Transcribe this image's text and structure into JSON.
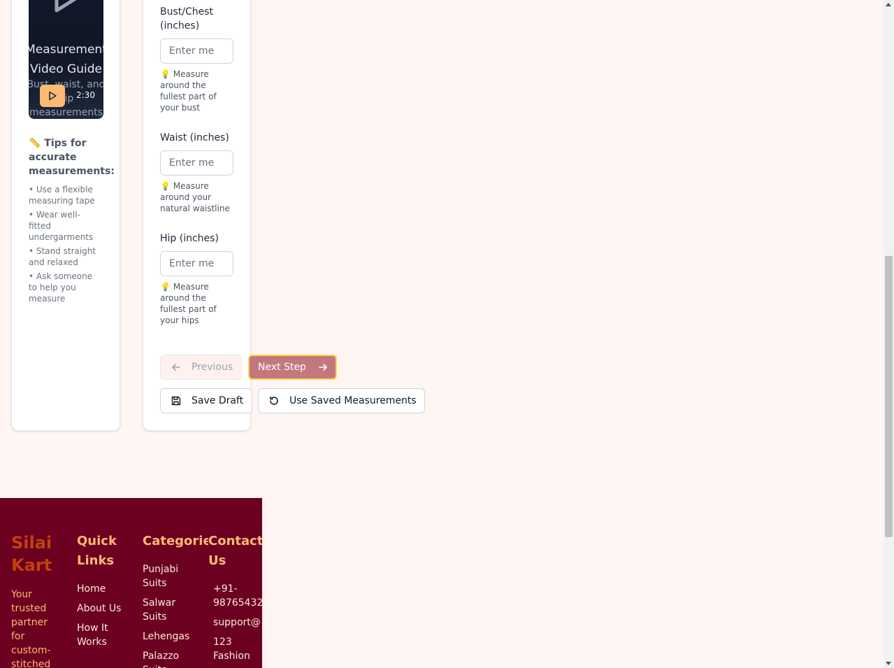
{
  "video_card": {
    "title": "Measurement\nVideo Guide",
    "subtitle": "Bust, waist, and hip measurements",
    "duration": "2:30",
    "tips_title": "📏 Tips for accurate measurements:",
    "tips": [
      "• Use a flexible measuring tape",
      "• Wear well-fitted undergarments",
      "• Stand straight and relaxed",
      "• Ask someone to help you measure"
    ]
  },
  "form": {
    "fields": [
      {
        "label": "Bust/Chest (inches)",
        "placeholder": "Enter me",
        "hint": "💡 Measure around the fullest part of your bust"
      },
      {
        "label": "Waist (inches)",
        "placeholder": "Enter me",
        "hint": "💡 Measure around your natural waistline"
      },
      {
        "label": "Hip (inches)",
        "placeholder": "Enter me",
        "hint": "💡 Measure around the fullest part of your hips"
      }
    ],
    "buttons": {
      "previous": "Previous",
      "next": "Next Step",
      "save_draft": "Save Draft",
      "use_saved": "Use Saved Measurements"
    }
  },
  "footer": {
    "brand": "Silai Kart",
    "tagline": "Your trusted partner for custom-stitched",
    "quick_links": {
      "title": "Quick Links",
      "items": [
        "Home",
        "About Us",
        "How It Works"
      ]
    },
    "categories": {
      "title": "Categories",
      "items": [
        "Punjabi Suits",
        "Salwar Suits",
        "Lehengas",
        "Palazzo Suits"
      ]
    },
    "contact": {
      "title": "Contact Us",
      "items": [
        "+91-98765432",
        "support@",
        "123 Fashion"
      ]
    }
  },
  "colors": {
    "page_bg": "#fff5f2",
    "footer_bg": "#6b0020",
    "accent": "#fdba74",
    "next_button": "#c2787c"
  }
}
